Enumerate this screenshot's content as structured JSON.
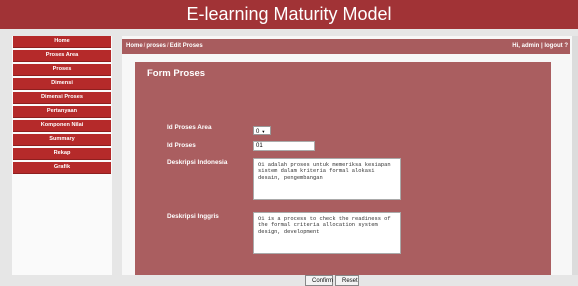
{
  "app": {
    "title": "E-learning Maturity Model"
  },
  "sidebar": {
    "items": [
      {
        "label": "Home"
      },
      {
        "label": "Proses Area"
      },
      {
        "label": "Proses"
      },
      {
        "label": "Dimensi"
      },
      {
        "label": "Dimensi Proses"
      },
      {
        "label": "Pertanyaan"
      },
      {
        "label": "Komponen Nilai"
      },
      {
        "label": "Summary"
      },
      {
        "label": "Rekap"
      },
      {
        "label": "Grafik"
      }
    ]
  },
  "breadcrumb": {
    "items": [
      "Home",
      "proses",
      "Edit Proses"
    ],
    "separator": "/"
  },
  "user": {
    "greeting": "Hi,",
    "name": "admin",
    "logout": "logout ?"
  },
  "form": {
    "title": "Form Proses",
    "fields": {
      "id_proses_area": {
        "label": "Id Proses Area",
        "value": "0"
      },
      "id_proses": {
        "label": "Id Proses",
        "value": "01"
      },
      "deskripsi_indonesia": {
        "label": "Deskripsi Indonesia",
        "value": "O1 adalah proses untuk memeriksa kesiapan sistem dalam kriteria formal alokasi desain, pengembangan"
      },
      "deskripsi_inggris": {
        "label": "Deskripsi Inggris",
        "value": "O1 is a process to check the readiness of the formal criteria allocation system design, development"
      }
    },
    "buttons": {
      "confirm": "Confirm",
      "reset": "Reset"
    }
  }
}
